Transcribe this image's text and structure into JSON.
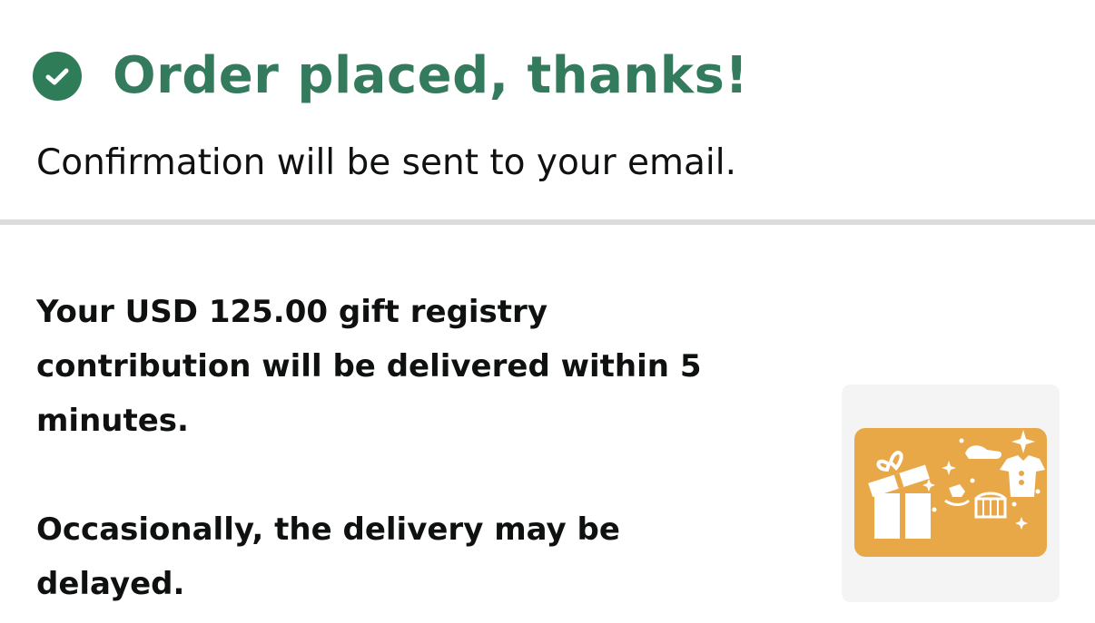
{
  "header": {
    "icon": "check-circle-icon",
    "title": "Order placed, thanks!",
    "accent_color": "#2f7c59"
  },
  "subtitle": "Confirmation will be sent to your email.",
  "message": {
    "delivery": "Your USD 125.00 gift registry contribution will be delivered within 5 minutes.",
    "delay": "Occasionally, the delivery may be delayed."
  },
  "gift_card": {
    "icon": "baby-registry-gift-card-icon",
    "color": "#e9a848"
  }
}
